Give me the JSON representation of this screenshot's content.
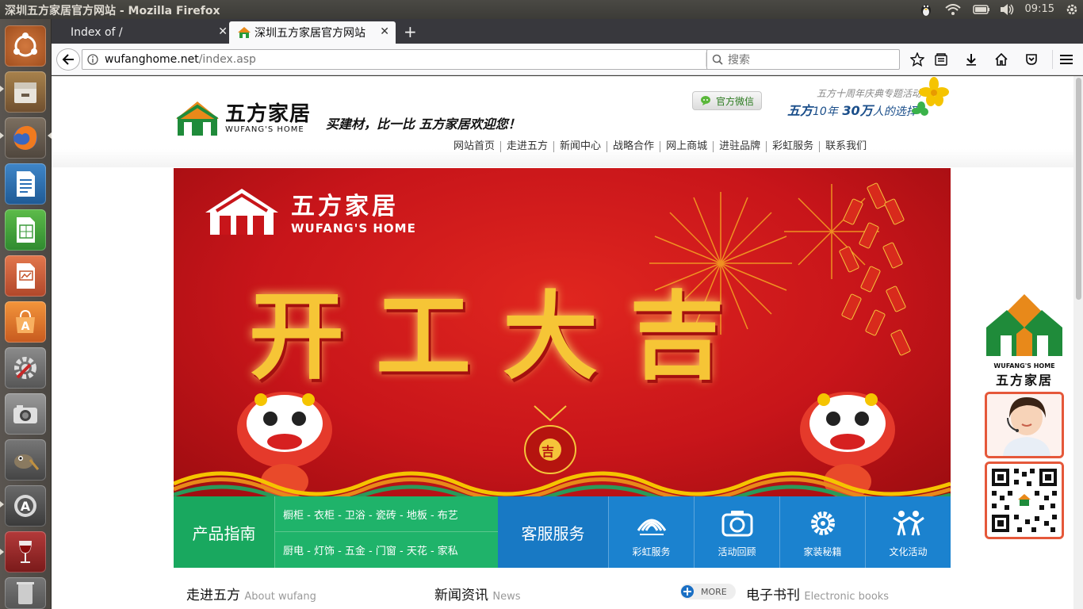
{
  "os": {
    "window_title": "深圳五方家居官方网站 - Mozilla Firefox",
    "clock": "09:15"
  },
  "launcher": {
    "items": [
      {
        "name": "dash",
        "color": "#c45a2a"
      },
      {
        "name": "files",
        "color": "#8a5a3a"
      },
      {
        "name": "firefox",
        "color": "#e66000"
      },
      {
        "name": "writer",
        "color": "#2a6fb5"
      },
      {
        "name": "calc",
        "color": "#3a9a3a"
      },
      {
        "name": "impress",
        "color": "#c4532a"
      },
      {
        "name": "software-center",
        "color": "#e06a2a"
      },
      {
        "name": "system-settings",
        "color": "#777"
      },
      {
        "name": "cheese",
        "color": "#888"
      },
      {
        "name": "gimp",
        "color": "#666"
      },
      {
        "name": "software-updater",
        "color": "#555"
      },
      {
        "name": "wine",
        "color": "#aa2a2a"
      }
    ]
  },
  "browser": {
    "tabs": [
      {
        "label": "Index of /"
      },
      {
        "label": "深圳五方家居官方网站"
      }
    ],
    "url_host": "wufanghome.net",
    "url_path": "/index.asp",
    "search_placeholder": "搜索"
  },
  "site": {
    "logo_cn": "五方家居",
    "logo_en": "WUFANG'S HOME",
    "slogan": "买建材，比一比 五方家居欢迎您！",
    "wechat_label": "官方微信",
    "anniversary_sub": "五方十周年庆典专题活动",
    "anniversary_main_a": "五方",
    "anniversary_main_b": "10年",
    "anniversary_main_c": "30万",
    "anniversary_main_d": "人的选择",
    "nav": [
      "网站首页",
      "走进五方",
      "新闻中心",
      "战略合作",
      "网上商城",
      "进驻品牌",
      "彩虹服务",
      "联系我们"
    ],
    "banner": {
      "logo_cn": "五方家居",
      "logo_en": "WUFANG'S HOME",
      "headline": "开工大吉",
      "coin_label": "吉"
    },
    "service_bar": {
      "product_guide": "产品指南",
      "cat_row_1": "橱柜 - 衣柜 - 卫浴 - 瓷砖 - 地板 - 布艺",
      "cat_row_2": "厨电 - 灯饰 - 五金 - 门窗 - 天花 - 家私",
      "customer_service": "客服服务",
      "items": [
        {
          "label": "彩虹服务",
          "icon": "rainbow-icon"
        },
        {
          "label": "活动回顾",
          "icon": "camera-icon"
        },
        {
          "label": "家装秘籍",
          "icon": "gear-icon"
        },
        {
          "label": "文化活动",
          "icon": "people-icon"
        }
      ]
    },
    "sections": {
      "about_title": "走进五方",
      "about_sub": "About wufang",
      "news_title": "新闻资讯",
      "news_sub": "News",
      "more_label": "MORE",
      "ebooks_title": "电子书刊",
      "ebooks_sub": "Electronic books"
    },
    "side": {
      "brand_en": "WUFANG'S HOME",
      "brand_cn": "五方家居"
    }
  }
}
